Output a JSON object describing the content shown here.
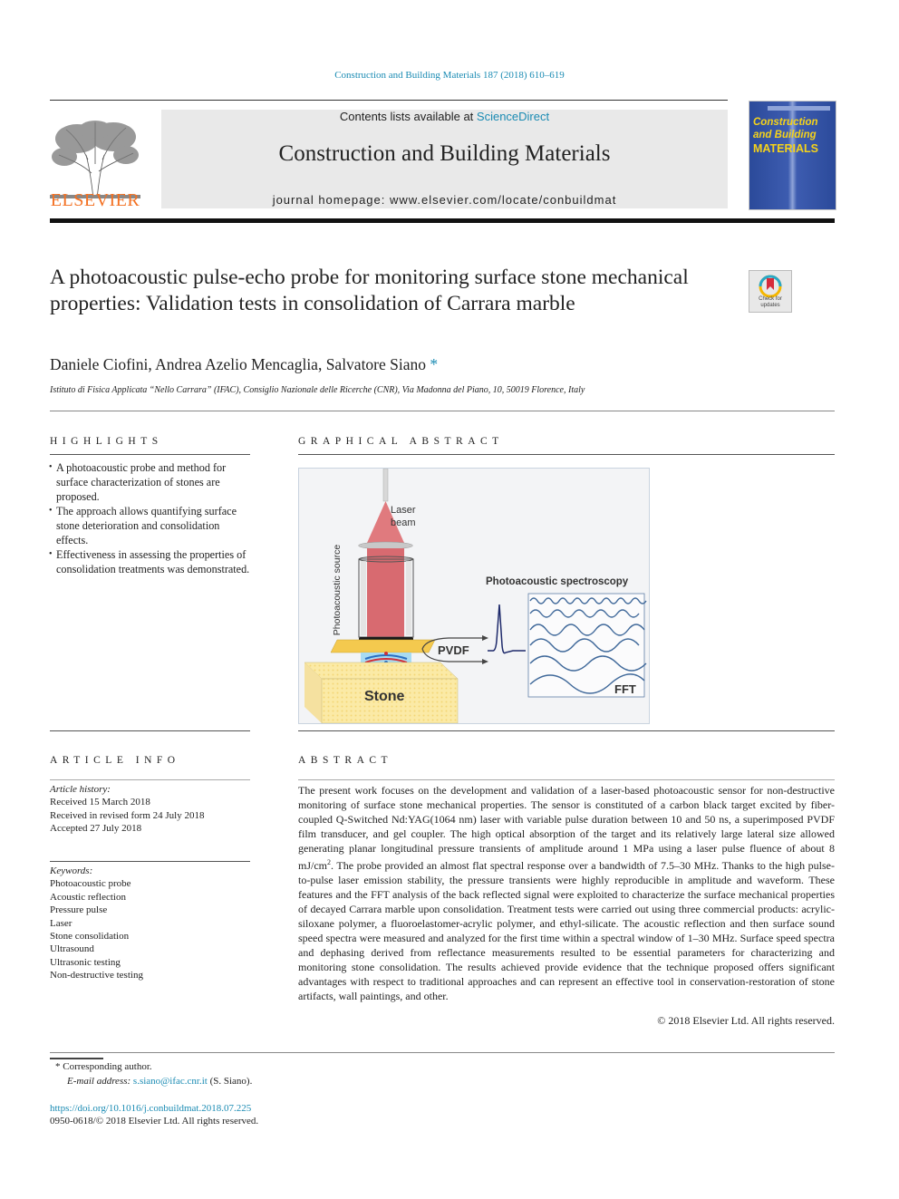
{
  "header": {
    "citation": "Construction and Building Materials 187 (2018) 610–619",
    "contents_prefix": "Contents lists available at ",
    "contents_link": "ScienceDirect",
    "journal_name": "Construction and Building Materials",
    "homepage": "journal homepage: www.elsevier.com/locate/conbuildmat",
    "publisher": "ELSEVIER",
    "cover": {
      "line1": "Construction",
      "line2": "and Building",
      "line3": "MATERIALS"
    },
    "crossmark_label_1": "Check for",
    "crossmark_label_2": "updates"
  },
  "article": {
    "title": "A photoacoustic pulse-echo probe for monitoring surface stone mechanical properties: Validation tests in consolidation of Carrara marble",
    "authors": "Daniele Ciofini, Andrea Azelio Mencaglia, Salvatore Siano",
    "author_mark": "*",
    "affiliation": "Istituto di Fisica Applicata “Nello Carrara” (IFAC), Consiglio Nazionale delle Ricerche (CNR), Via Madonna del Piano, 10, 50019 Florence, Italy"
  },
  "highlights": {
    "heading": "HIGHLIGHTS",
    "items": [
      "A photoacoustic probe and method for surface characterization of stones are proposed.",
      "The approach allows quantifying surface stone deterioration and consolidation effects.",
      "Effectiveness in assessing the properties of consolidation treatments was demonstrated."
    ]
  },
  "graphical_abstract": {
    "heading": "GRAPHICAL ABSTRACT",
    "labels": {
      "laser_beam_1": "Laser",
      "laser_beam_2": "beam",
      "photoacoustic_source": "Photoacoustic source",
      "pvdf": "PVDF",
      "stone": "Stone",
      "spectroscopy": "Photoacoustic spectroscopy",
      "fft": "FFT"
    }
  },
  "article_info": {
    "heading": "ARTICLE INFO",
    "history_label": "Article history:",
    "history": [
      "Received 15 March 2018",
      "Received in revised form 24 July 2018",
      "Accepted 27 July 2018"
    ],
    "keywords_label": "Keywords:",
    "keywords": [
      "Photoacoustic probe",
      "Acoustic reflection",
      "Pressure pulse",
      "Laser",
      "Stone consolidation",
      "Ultrasound",
      "Ultrasonic testing",
      "Non-destructive testing"
    ]
  },
  "abstract": {
    "heading": "ABSTRACT",
    "text_before_sup": "The present work focuses on the development and validation of a laser-based photoacoustic sensor for non-destructive monitoring of surface stone mechanical properties. The sensor is constituted of a carbon black target excited by fiber-coupled Q-Switched Nd:YAG(1064 nm) laser with variable pulse duration between 10 and 50 ns, a superimposed PVDF film transducer, and gel coupler. The high optical absorption of the target and its relatively large lateral size allowed generating planar longitudinal pressure transients of amplitude around 1 MPa using a laser pulse fluence of about 8 mJ/cm",
    "sup": "2",
    "text_after_sup": ". The probe provided an almost flat spectral response over a bandwidth of 7.5–30 MHz. Thanks to the high pulse-to-pulse laser emission stability, the pressure transients were highly reproducible in amplitude and waveform. These features and the FFT analysis of the back reflected signal were exploited to characterize the surface mechanical properties of decayed Carrara marble upon consolidation. Treatment tests were carried out using three commercial products: acrylic-siloxane polymer, a fluoroelastomer-acrylic polymer, and ethyl-silicate. The acoustic reflection and then surface sound speed spectra were measured and analyzed for the first time within a spectral window of 1–30 MHz. Surface speed spectra and dephasing derived from reflectance measurements resulted to be essential parameters for characterizing and monitoring stone consolidation. The results achieved provide evidence that the technique proposed offers significant advantages with respect to traditional approaches and can represent an effective tool in conservation-restoration of stone artifacts, wall paintings, and other.",
    "copyright": "© 2018 Elsevier Ltd. All rights reserved."
  },
  "footer": {
    "corresponding_mark": "*",
    "corresponding": "Corresponding author.",
    "email_label": "E-mail address:",
    "email": "s.siano@ifac.cnr.it",
    "email_suffix": "(S. Siano).",
    "doi": "https://doi.org/10.1016/j.conbuildmat.2018.07.225",
    "issn": "0950-0618/© 2018 Elsevier Ltd. All rights reserved."
  }
}
